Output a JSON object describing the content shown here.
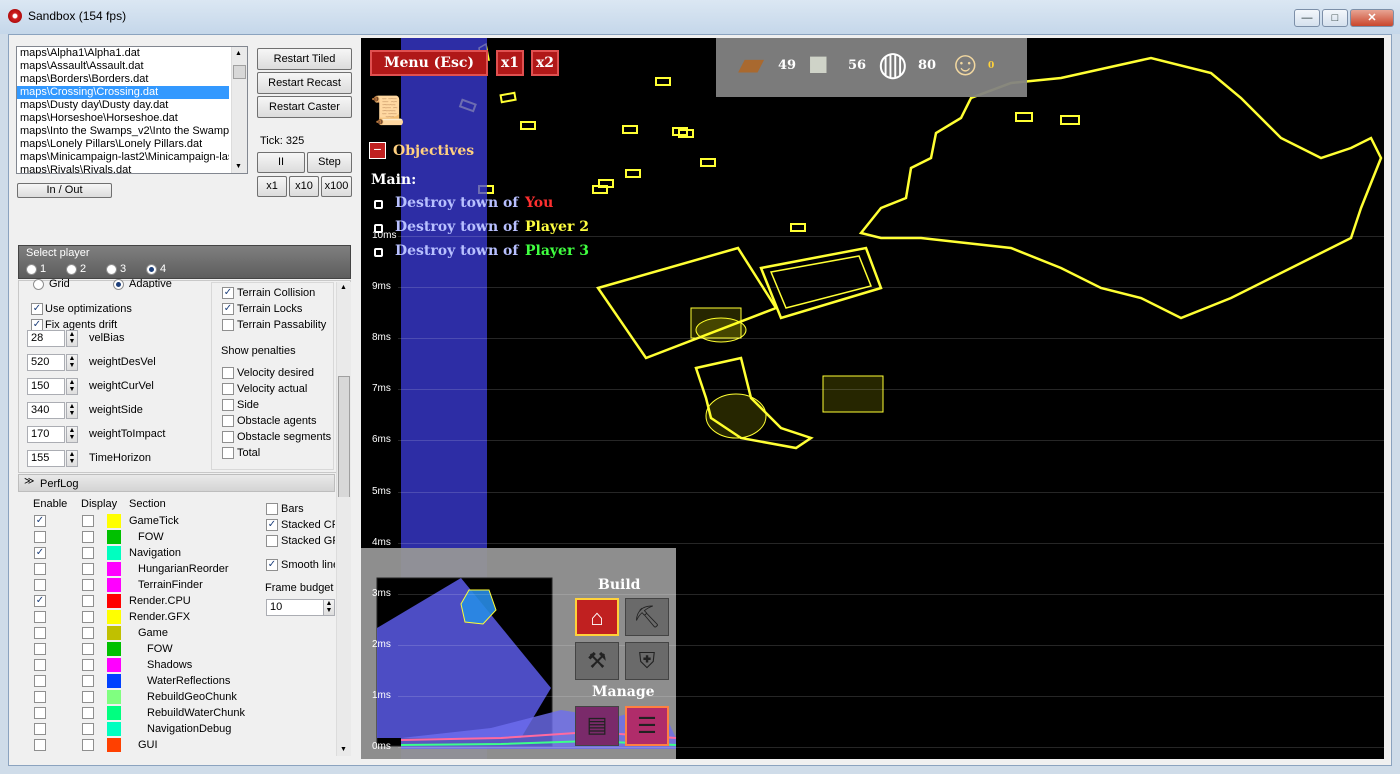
{
  "window": {
    "title": "Sandbox (154 fps)",
    "minimize": "—",
    "maximize": "□",
    "close": "✕"
  },
  "maps": {
    "items": [
      "maps\\Alpha1\\Alpha1.dat",
      "maps\\Assault\\Assault.dat",
      "maps\\Borders\\Borders.dat",
      "maps\\Crossing\\Crossing.dat",
      "maps\\Dusty day\\Dusty day.dat",
      "maps\\Horseshoe\\Horseshoe.dat",
      "maps\\Into the Swamps_v2\\Into the Swamps",
      "maps\\Lonely Pillars\\Lonely Pillars.dat",
      "maps\\Minicampaign-last2\\Minicampaign-last",
      "maps\\Rivals\\Rivals.dat"
    ],
    "selected": 3
  },
  "controls": {
    "restart_tiled": "Restart Tiled",
    "restart_recast": "Restart Recast",
    "restart_caster": "Restart Caster",
    "tick": "Tick: 325",
    "pause": "II",
    "step": "Step",
    "x1": "x1",
    "x10": "x10",
    "x100": "x100",
    "in_out": "In / Out"
  },
  "select_player": {
    "label": "Select player",
    "options": [
      "1",
      "2",
      "3",
      "4"
    ],
    "selected": "4"
  },
  "nav": {
    "grid": "Grid",
    "adaptive": "Adaptive",
    "use_optimizations": "Use optimizations",
    "fix_agents_drift": "Fix agents drift",
    "params": [
      {
        "value": "28",
        "label": "velBias"
      },
      {
        "value": "520",
        "label": "weightDesVel"
      },
      {
        "value": "150",
        "label": "weightCurVel"
      },
      {
        "value": "340",
        "label": "weightSide"
      },
      {
        "value": "170",
        "label": "weightToImpact"
      },
      {
        "value": "155",
        "label": "TimeHorizon"
      }
    ],
    "terrain": [
      {
        "label": "Terrain Collision",
        "checked": true
      },
      {
        "label": "Terrain Locks",
        "checked": true
      },
      {
        "label": "Terrain Passability",
        "checked": false
      }
    ],
    "show_penalties": "Show penalties",
    "penalties": [
      "Velocity desired",
      "Velocity actual",
      "Side",
      "Obstacle agents",
      "Obstacle segments",
      "Total"
    ]
  },
  "perflog": {
    "title": "PerfLog",
    "col_enable": "Enable",
    "col_display": "Display",
    "col_section": "Section",
    "rows": [
      {
        "name": "GameTick",
        "enable": true,
        "color": "#ffff00",
        "indent": 0
      },
      {
        "name": "FOW",
        "enable": false,
        "color": "#00c000",
        "indent": 1
      },
      {
        "name": "Navigation",
        "enable": true,
        "color": "#00ffc0",
        "indent": 0
      },
      {
        "name": "HungarianReorder",
        "enable": false,
        "color": "#ff00ff",
        "indent": 1
      },
      {
        "name": "TerrainFinder",
        "enable": false,
        "color": "#ff00ff",
        "indent": 1
      },
      {
        "name": "Render.CPU",
        "enable": true,
        "color": "#ff0000",
        "indent": 0
      },
      {
        "name": "Render.GFX",
        "enable": false,
        "color": "#ffff00",
        "indent": 0
      },
      {
        "name": "Game",
        "enable": false,
        "color": "#c0c000",
        "indent": 1
      },
      {
        "name": "FOW",
        "enable": false,
        "color": "#00c000",
        "indent": 2
      },
      {
        "name": "Shadows",
        "enable": false,
        "color": "#ff00ff",
        "indent": 2
      },
      {
        "name": "WaterReflections",
        "enable": false,
        "color": "#0040ff",
        "indent": 2
      },
      {
        "name": "RebuildGeoChunk",
        "enable": false,
        "color": "#80ff80",
        "indent": 2
      },
      {
        "name": "RebuildWaterChunk",
        "enable": false,
        "color": "#00ff80",
        "indent": 2
      },
      {
        "name": "NavigationDebug",
        "enable": false,
        "color": "#00ffc0",
        "indent": 2
      },
      {
        "name": "GUI",
        "enable": false,
        "color": "#ff4000",
        "indent": 1
      }
    ],
    "bars": "Bars",
    "stacked_cpu": "Stacked CF",
    "stacked_gfx": "Stacked GF",
    "smooth_lines": "Smooth line",
    "frame_budget_label": "Frame budget",
    "frame_budget": "10"
  },
  "game": {
    "menu": "Menu (Esc)",
    "speed1": "x1",
    "speed2": "x2",
    "resources": [
      {
        "icon": "wood-plank-icon",
        "value": "49"
      },
      {
        "icon": "stone-block-icon",
        "value": "56"
      },
      {
        "icon": "food-plate-icon",
        "value": "80"
      },
      {
        "icon": "serf-icon",
        "value": "0"
      }
    ],
    "objectives_title": "Objectives",
    "main": "Main:",
    "objectives": [
      {
        "text": "Destroy town of ",
        "who": "You",
        "color": "#ff3030"
      },
      {
        "text": "Destroy town of ",
        "who": "Player 2",
        "color": "#ffff40"
      },
      {
        "text": "Destroy town of ",
        "who": "Player 3",
        "color": "#40ff40"
      }
    ],
    "ms_labels": [
      "10ms",
      "9ms",
      "8ms",
      "7ms",
      "6ms",
      "5ms",
      "4ms",
      "3ms",
      "2ms",
      "1ms",
      "0ms"
    ],
    "build": "Build",
    "manage": "Manage"
  }
}
